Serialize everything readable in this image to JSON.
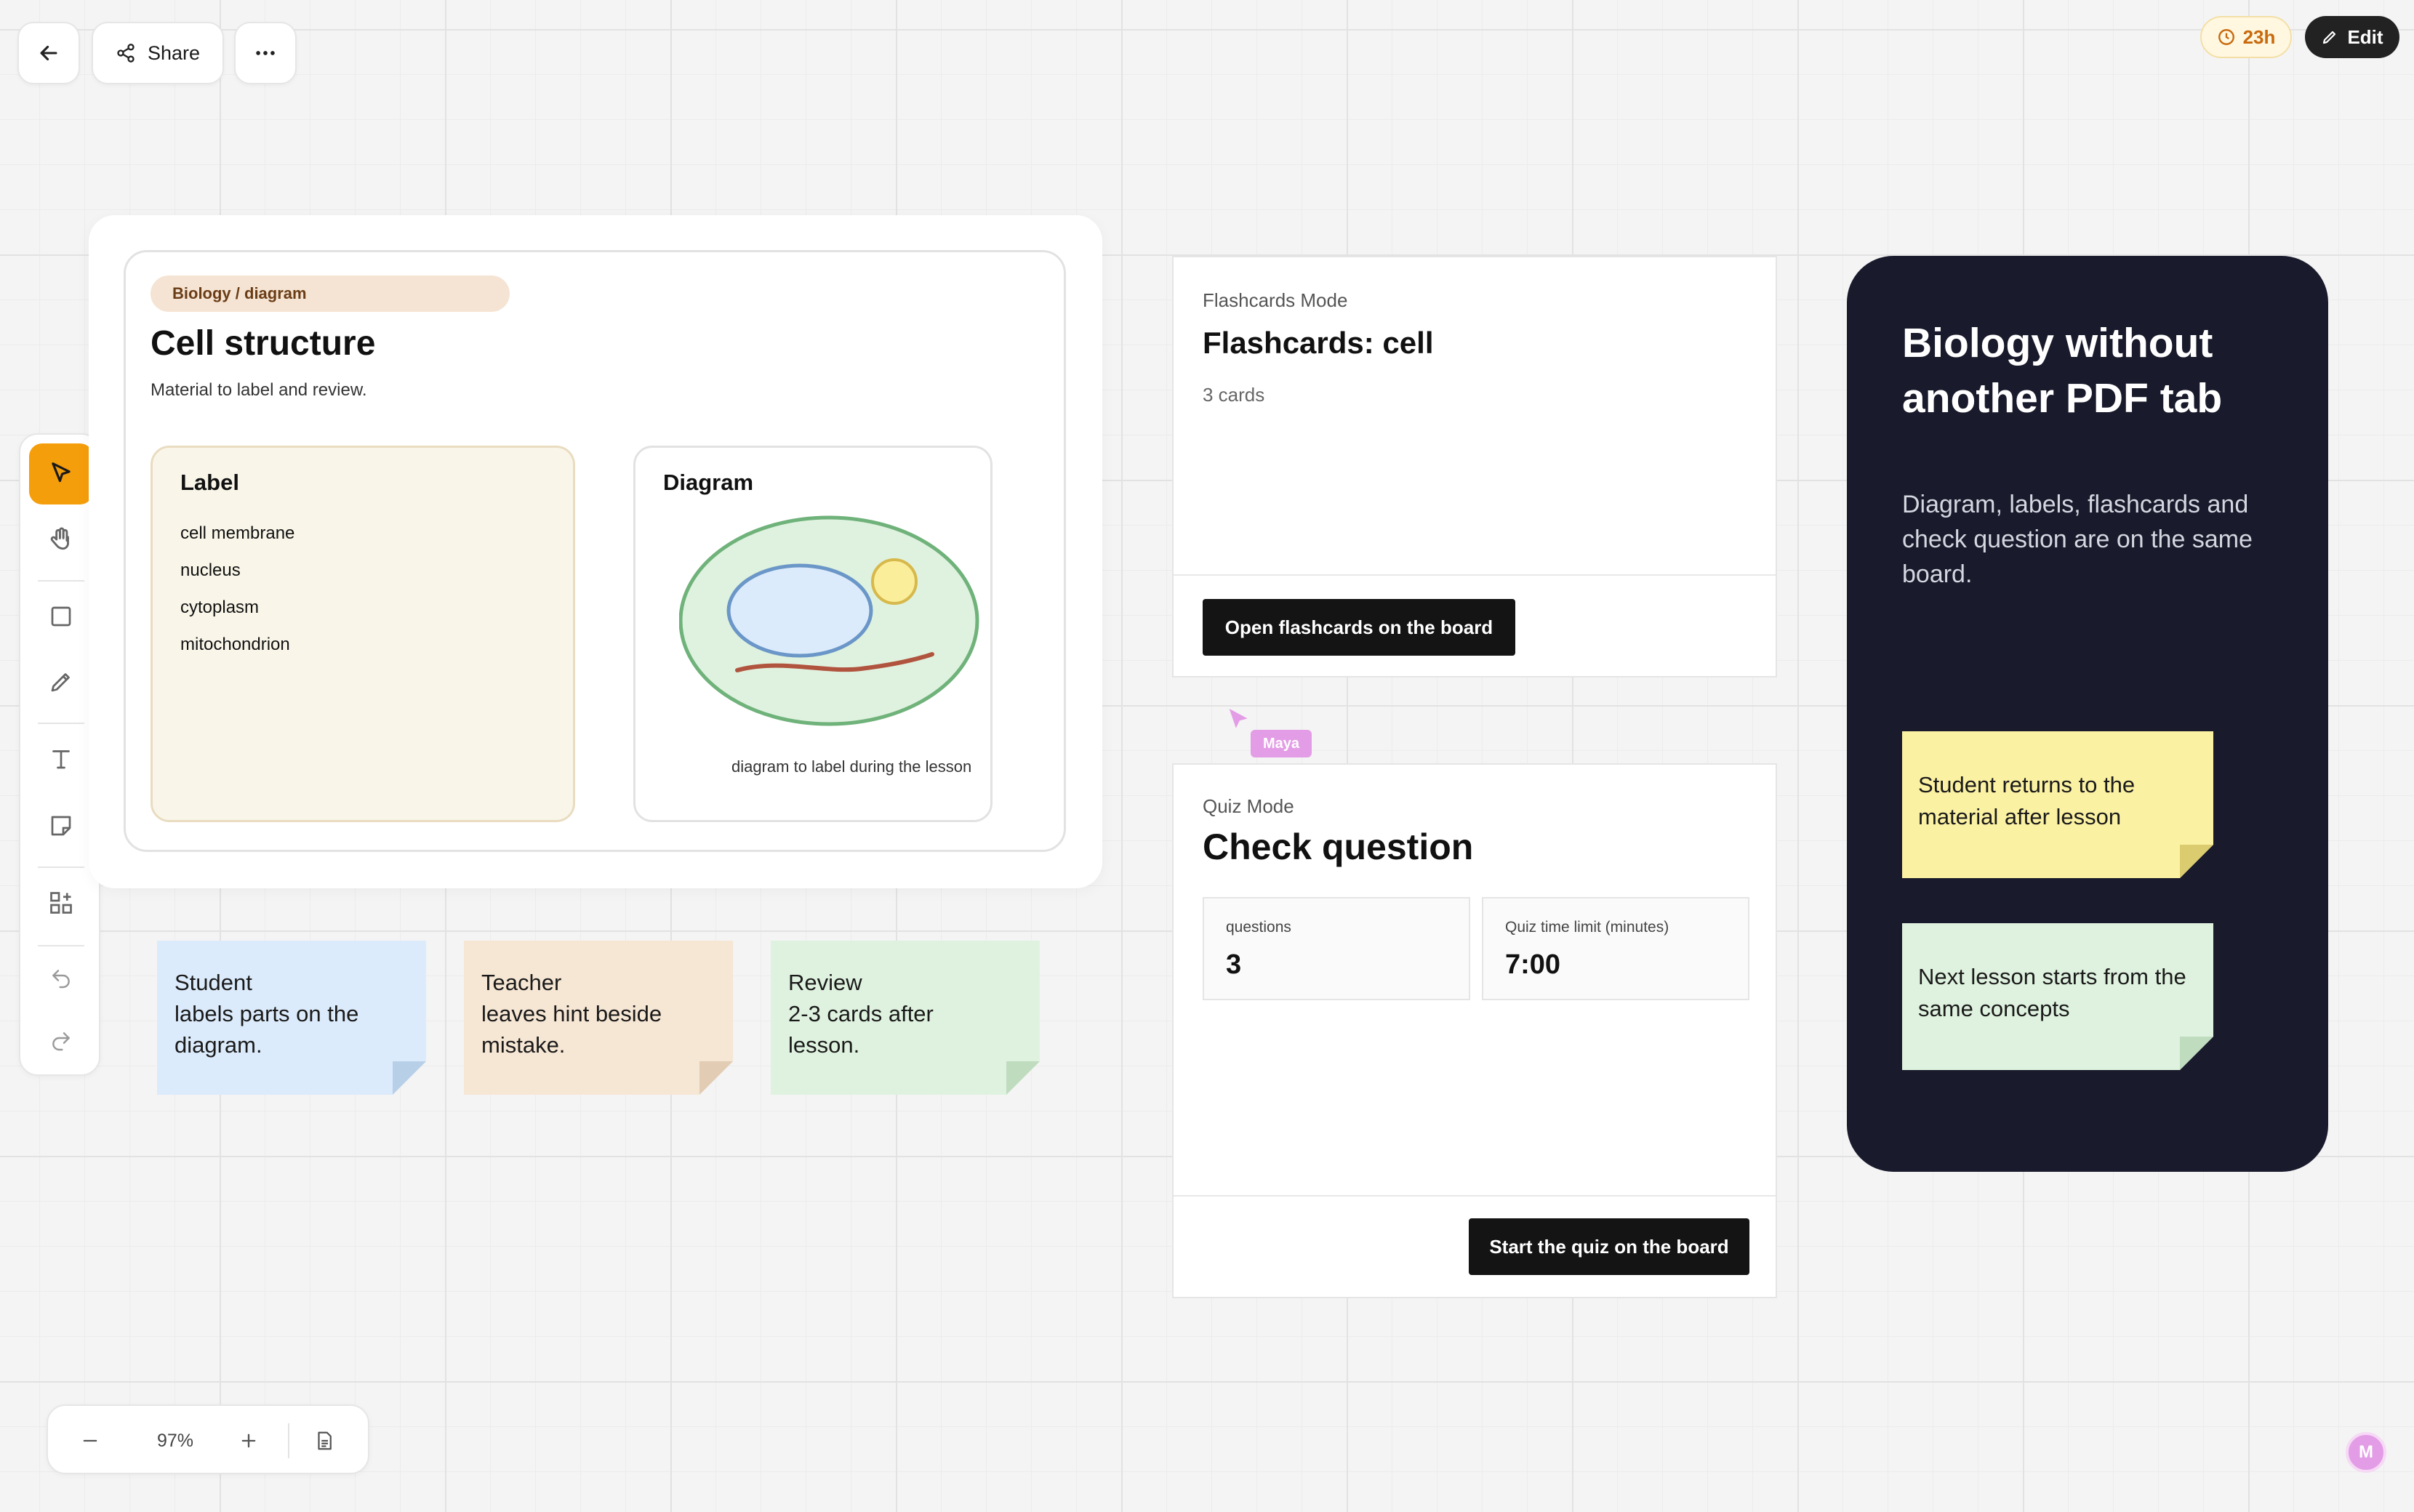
{
  "header": {
    "share_label": "Share",
    "timer_label": "23h",
    "edit_label": "Edit"
  },
  "toolbar": {
    "tools": [
      "select",
      "hand",
      "rectangle",
      "pencil",
      "text",
      "sticky-note",
      "components",
      "undo",
      "redo"
    ],
    "active_tool": "select",
    "accent_color": "#f59e0b"
  },
  "cell_card": {
    "tag": "Biology / diagram",
    "title": "Cell structure",
    "subtitle": "Material to label and review.",
    "label_box": {
      "title": "Label",
      "items": [
        "cell membrane",
        "nucleus",
        "cytoplasm",
        "mitochondrion"
      ]
    },
    "diagram_box": {
      "title": "Diagram",
      "caption": "diagram to label during the lesson"
    }
  },
  "stickies": [
    {
      "text": "Student\nlabels parts on the\ndiagram.",
      "color": "#dcebfb"
    },
    {
      "text": "Teacher\nleaves hint beside\nmistake.",
      "color": "#f6e6d4"
    },
    {
      "text": "Review\n2-3 cards after\nlesson.",
      "color": "#dff2df"
    }
  ],
  "flashcards": {
    "mode": "Flashcards Mode",
    "title": "Flashcards: cell",
    "count": "3 cards",
    "button": "Open flashcards on the board"
  },
  "cursor": {
    "name": "Maya",
    "color": "#e39de6"
  },
  "quiz": {
    "mode": "Quiz Mode",
    "title": "Check question",
    "questions_label": "questions",
    "questions_value": "3",
    "time_label": "Quiz time limit (minutes)",
    "time_value": "7:00",
    "button": "Start the quiz on the board"
  },
  "promo": {
    "title": "Biology without another PDF tab",
    "text": "Diagram, labels, flashcards and check question are on the same board.",
    "notes": [
      {
        "text": "Student returns to the material after lesson",
        "color": "#fbf1a3"
      },
      {
        "text": "Next lesson starts from the same concepts",
        "color": "#dff2df"
      }
    ]
  },
  "zoom": {
    "level": "97%"
  },
  "user": {
    "initial": "M"
  }
}
